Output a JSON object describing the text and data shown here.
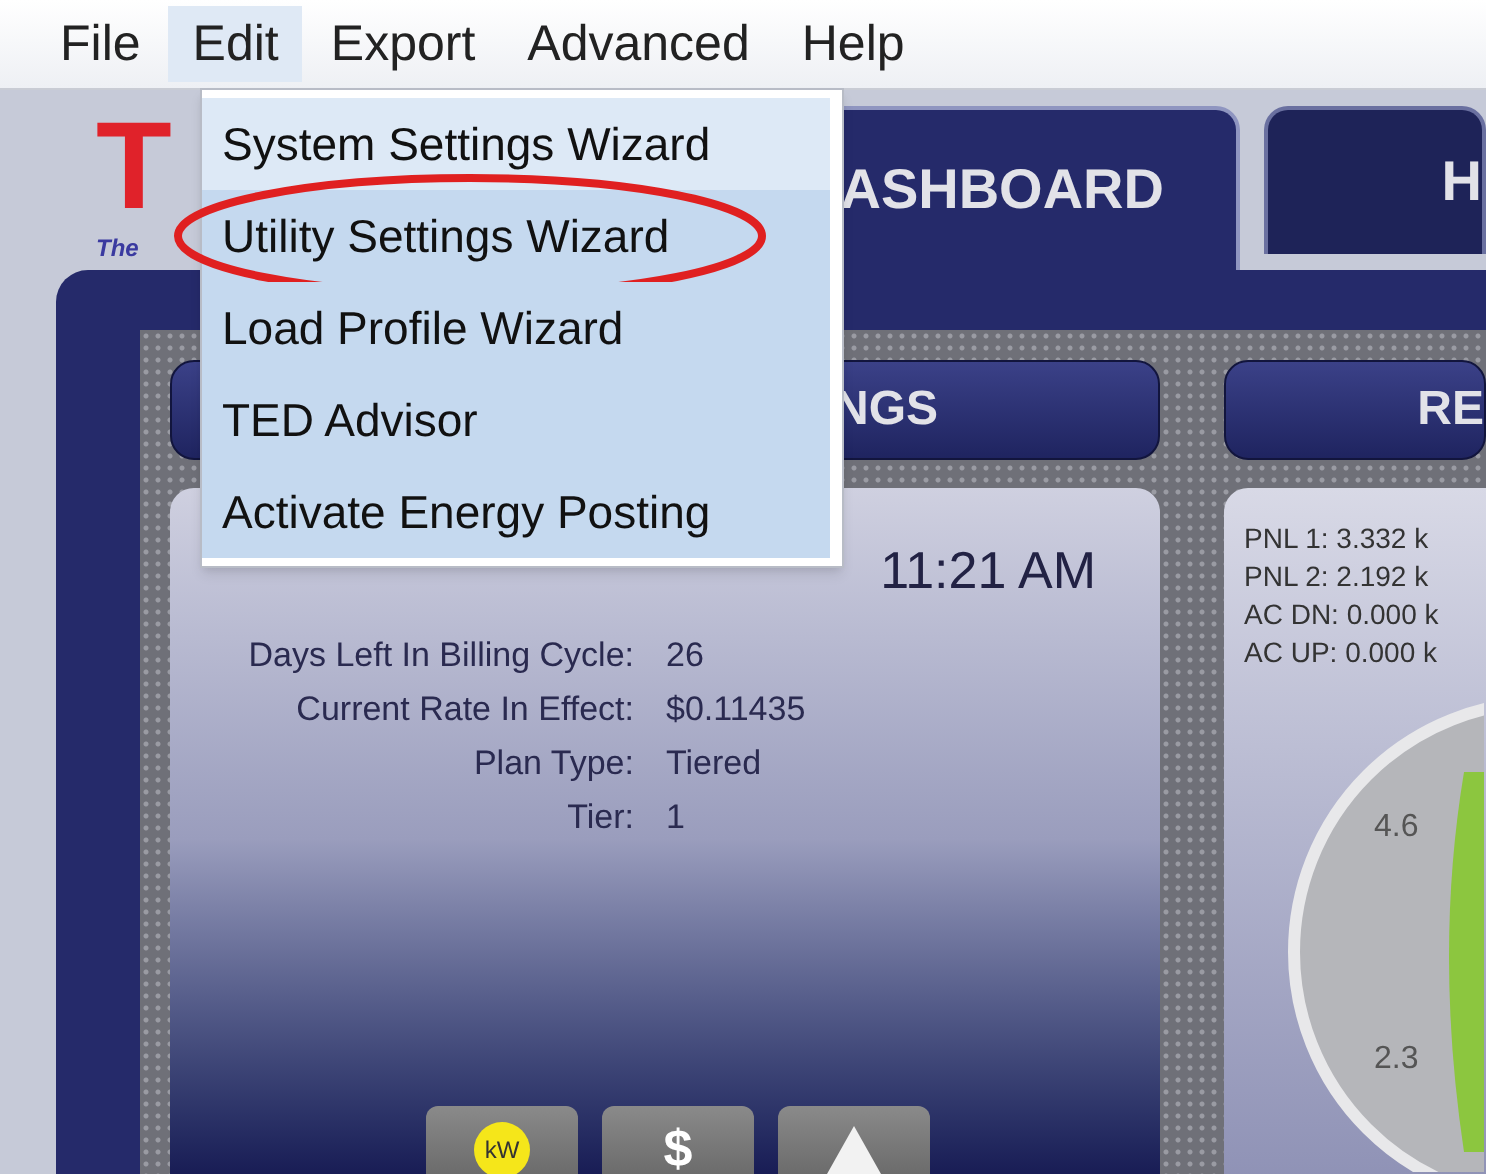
{
  "menu_bar": {
    "items": [
      {
        "label": "File",
        "selected": false
      },
      {
        "label": "Edit",
        "selected": true
      },
      {
        "label": "Export",
        "selected": false
      },
      {
        "label": "Advanced",
        "selected": false
      },
      {
        "label": "Help",
        "selected": false
      }
    ]
  },
  "dropdown": {
    "items": [
      {
        "label": "System Settings Wizard",
        "highlighted": true,
        "circled": false
      },
      {
        "label": "Utility Settings Wizard",
        "highlighted": false,
        "circled": true
      },
      {
        "label": "Load Profile Wizard",
        "highlighted": false,
        "circled": false
      },
      {
        "label": "TED Advisor",
        "highlighted": false,
        "circled": false
      },
      {
        "label": "Activate Energy Posting",
        "highlighted": false,
        "circled": false
      }
    ]
  },
  "logo": {
    "letter": "T",
    "tagline": "The"
  },
  "tabs": [
    {
      "label": "ASHBOARD",
      "selected": true
    },
    {
      "label": "H",
      "selected": false
    }
  ],
  "panels": [
    {
      "title": "NGS"
    },
    {
      "title": "RE"
    }
  ],
  "info": {
    "time": "11:21 AM",
    "rows": [
      {
        "label": "Days Left In Billing Cycle:",
        "value": "26"
      },
      {
        "label": "Current Rate In Effect:",
        "value": "$0.11435"
      },
      {
        "label": "Plan Type:",
        "value": "Tiered"
      },
      {
        "label": "Tier:",
        "value": "1"
      }
    ]
  },
  "buttons": [
    {
      "kind": "kw",
      "label": "kW"
    },
    {
      "kind": "dollar",
      "label": "$"
    },
    {
      "kind": "co2"
    }
  ],
  "readings": [
    "PNL 1: 3.332 k",
    "PNL 2: 2.192 k",
    "AC DN: 0.000 k",
    "AC UP: 0.000 k"
  ],
  "gauge": {
    "ticks": [
      "4.6",
      "2.3"
    ]
  }
}
